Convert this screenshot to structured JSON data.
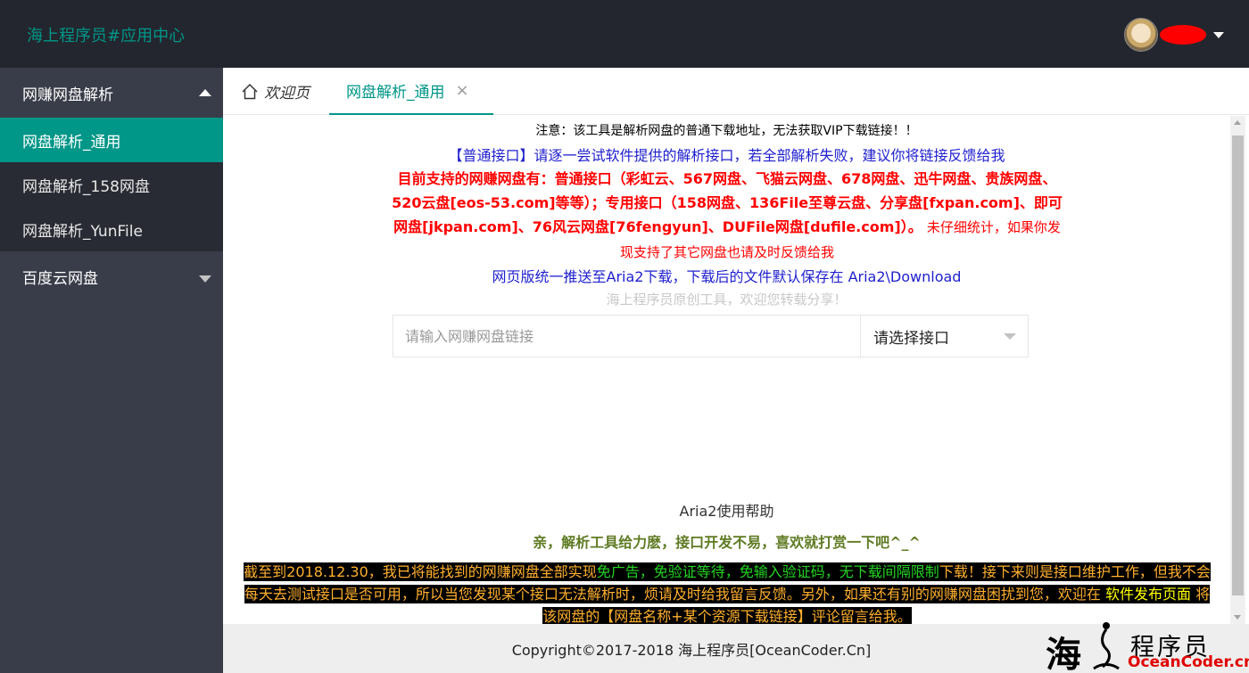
{
  "header": {
    "title": "海上程序员#应用中心",
    "user_name": "",
    "avatar_icon": "avatar",
    "dropdown_icon": "chevron-down-icon"
  },
  "sidebar": {
    "groups": [
      {
        "label": "网赚网盘解析",
        "expanded": true,
        "items": [
          {
            "label": "网盘解析_通用",
            "active": true
          },
          {
            "label": "网盘解析_158网盘",
            "active": false
          },
          {
            "label": "网盘解析_YunFile",
            "active": false
          }
        ]
      },
      {
        "label": "百度云网盘",
        "expanded": false,
        "items": []
      }
    ]
  },
  "tabs": {
    "home_label": "欢迎页",
    "active_label": "网盘解析_通用",
    "close_glyph": "×"
  },
  "main": {
    "notice": "注意：该工具是解析网盘的普通下载地址，无法获取VIP下载链接！！",
    "common_interface": "【普通接口】请逐一尝试软件提供的解析接口，若全部解析失败，建议你将链接反馈给我",
    "supported_bold": "目前支持的网赚网盘有：普通接口（彩虹云、567网盘、飞猫云网盘、678网盘、迅牛网盘、贵族网盘、520云盘[eos-53.com]等等）；专用接口（158网盘、136File至尊云盘、分享盘[fxpan.com]、即可网盘[jkpan.com]、76风云网盘[76fengyun]、DUFile网盘[dufile.com]）。",
    "supported_thin": "未仔细统计，如果你发现支持了其它网盘也请及时反馈给我",
    "aria_note": "网页版统一推送至Aria2下载，下载后的文件默认保存在 Aria2\\Download",
    "original_note": "海上程序员原创工具，欢迎您转载分享！",
    "link_input_placeholder": "请输入网赚网盘链接",
    "link_input_value": "",
    "interface_select": "请选择接口",
    "aria_help": "Aria2使用帮助",
    "reward_tip": "亲，解析工具给力麽，接口开发不易，喜欢就打赏一下吧^_^",
    "announcement": {
      "part1": "截至到2018.12.30，我已将能找到的网赚网盘全部实现",
      "green": "免广告，免验证等待，免输入验证码，无下载间隔限制",
      "part2": "下载！接下来则是接口维护工作，但我不会每天去测试接口是否可用，所以当您发现某个接口无法解析时，烦请及时给我留言反馈。另外，如果还有别的网赚网盘困扰到您，欢迎在 ",
      "link": "软件发布页面",
      "part3": " 将该网盘的【网盘名称+某个资源下载链接】评论留言给我。"
    }
  },
  "footer": {
    "copyright": "Copyright©2017-2018 海上程序员[OceanCoder.Cn]",
    "watermark_char": "海",
    "watermark_cn": "程序员",
    "watermark_en": "OceanCoder.cn"
  },
  "colors": {
    "accent": "#009688",
    "header_bg": "#23262e",
    "sidebar_bg": "#393d49",
    "sidebar_sub_bg": "#282b33",
    "notice_blue": "#1e1ecf",
    "notice_red": "#ff0000",
    "tip_green": "#5f7b23",
    "highlight_orange": "#ffb02e"
  }
}
